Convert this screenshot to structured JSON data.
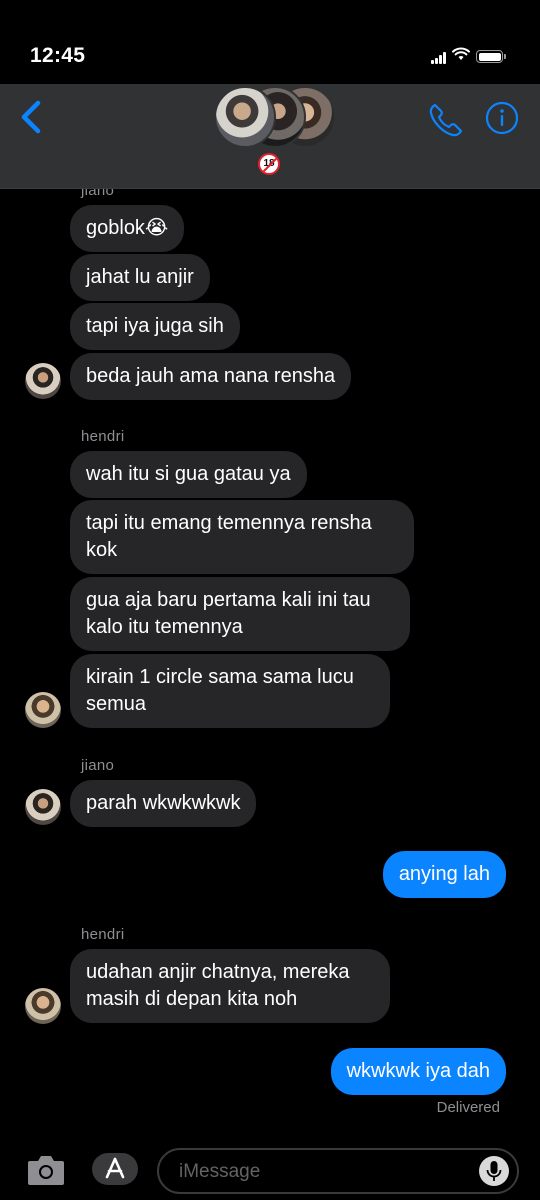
{
  "status_bar": {
    "time": "12:45"
  },
  "header": {
    "group_badge_text": "18",
    "group_badge_icon": "no-under-18-emoji"
  },
  "messages": [
    {
      "sender_label": "jiano"
    },
    {
      "text": "goblok😭"
    },
    {
      "text": "jahat lu anjir"
    },
    {
      "text": "tapi iya juga sih"
    },
    {
      "text": "beda jauh ama nana rensha"
    },
    {
      "sender_label": "hendri"
    },
    {
      "text": "wah itu si gua gatau ya"
    },
    {
      "text": "tapi itu emang temennya rensha kok"
    },
    {
      "text": "gua aja baru pertama kali ini tau kalo itu temennya"
    },
    {
      "text": "kirain 1 circle sama sama lucu semua"
    },
    {
      "sender_label": "jiano"
    },
    {
      "text": "parah wkwkwkwk"
    },
    {
      "text": "anying lah"
    },
    {
      "sender_label": "hendri"
    },
    {
      "text": "udahan anjir chatnya, mereka masih di depan kita noh"
    },
    {
      "text": "wkwkwk iya dah"
    }
  ],
  "delivered": "Delivered",
  "input": {
    "placeholder": "iMessage"
  },
  "colors": {
    "sent_bubble": "#0a84ff",
    "received_bubble": "#262628",
    "accent": "#0a84ff"
  }
}
